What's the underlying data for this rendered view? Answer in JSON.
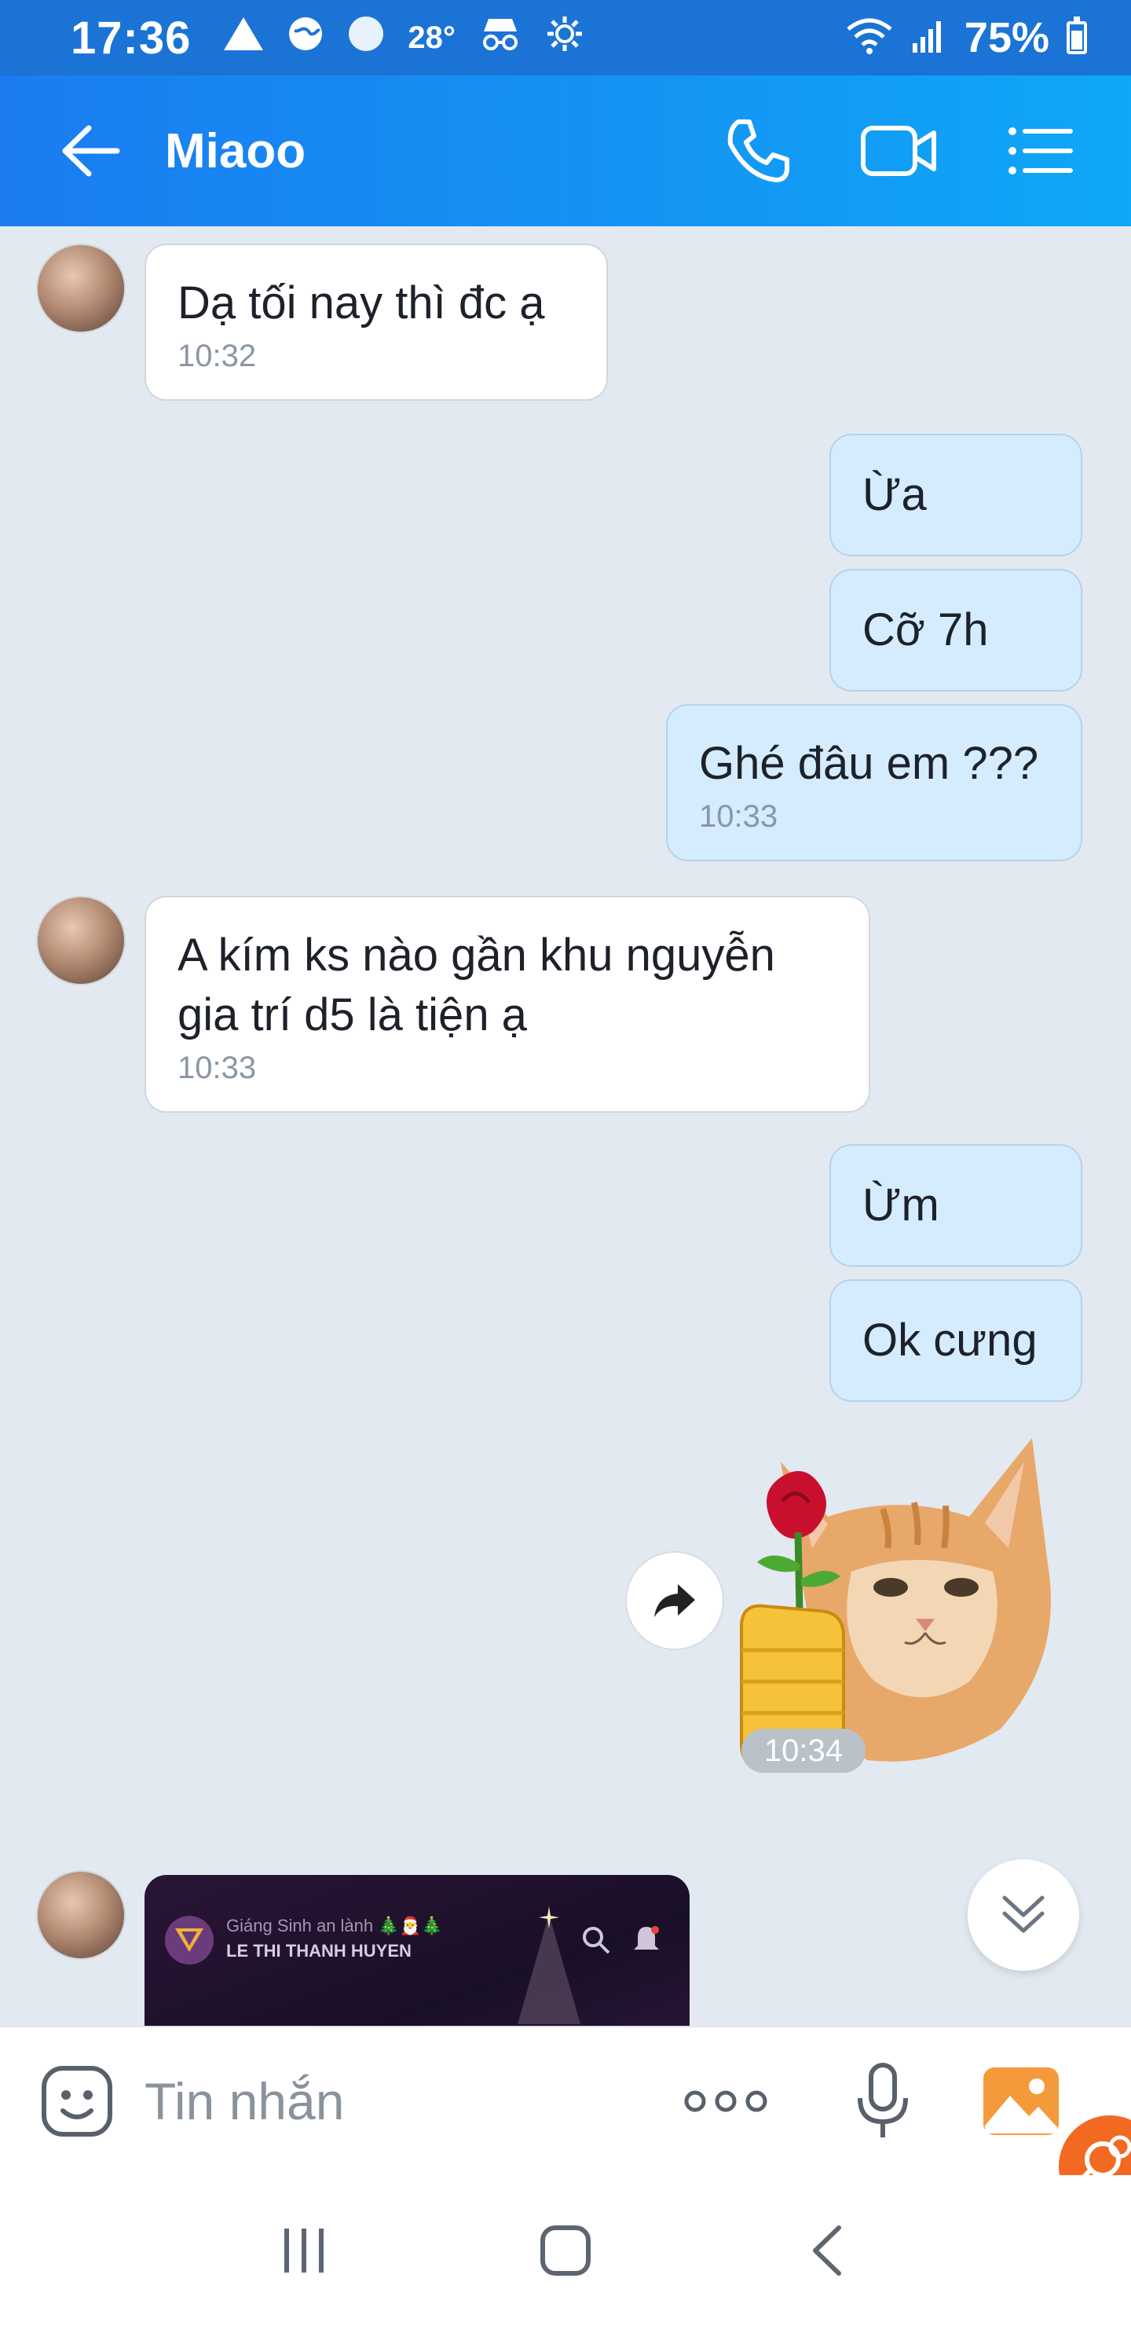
{
  "status_bar": {
    "time": "17:36",
    "temperature": "28°",
    "battery_text": "75%",
    "icons": [
      "alert-triangle-icon",
      "globe-icon",
      "circle-icon",
      "incognito-icon",
      "settings-gear-icon",
      "wifi-icon",
      "signal-icon",
      "battery-icon"
    ]
  },
  "header": {
    "title": "Miaoo",
    "back_icon": "arrow-left-icon",
    "call_icon": "phone-icon",
    "video_icon": "video-camera-icon",
    "menu_icon": "list-menu-icon"
  },
  "messages": [
    {
      "side": "in",
      "text": "Dạ tối nay thì đc ạ",
      "time": "10:32"
    },
    {
      "side": "out",
      "text": "Ừa",
      "time": ""
    },
    {
      "side": "out",
      "text": "Cỡ 7h",
      "time": ""
    },
    {
      "side": "out",
      "text": "Ghé đâu em ???",
      "time": "10:33"
    },
    {
      "side": "in",
      "text": "A kím ks nào gần khu nguyễn gia trí d5 là tiện ạ",
      "time": "10:33"
    },
    {
      "side": "out",
      "text": "Ừm",
      "time": ""
    },
    {
      "side": "out",
      "text": "Ok cưng",
      "time": ""
    }
  ],
  "sticker": {
    "description_icon": "cat-with-rose-sticker",
    "time": "10:34"
  },
  "shared_card": {
    "line1": "Giáng Sinh an lành 🎄🎅🎄",
    "line2": "LE THI THANH HUYEN"
  },
  "input_bar": {
    "placeholder": "Tin nhắn",
    "emoji_icon": "emoji-icon",
    "more_icon": "more-dots-icon",
    "mic_icon": "microphone-icon",
    "gallery_icon": "image-gallery-icon"
  },
  "nav_bar": {
    "icons": [
      "recent-apps-icon",
      "home-icon",
      "back-icon"
    ]
  },
  "colors": {
    "header_start": "#1a7cf0",
    "header_end": "#0fa7f7",
    "outgoing_bubble": "#d4ecfe",
    "incoming_bubble": "#ffffff",
    "chat_background": "#e2e9f1"
  }
}
